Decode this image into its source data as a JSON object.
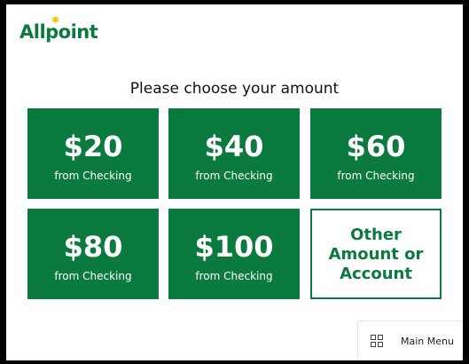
{
  "brand": {
    "name": "Allpoint",
    "color": "#0b7a3e",
    "star_color": "#f2c500"
  },
  "prompt": "Please choose your amount",
  "options": [
    {
      "amount": "$20",
      "source": "from Checking"
    },
    {
      "amount": "$40",
      "source": "from Checking"
    },
    {
      "amount": "$60",
      "source": "from Checking"
    },
    {
      "amount": "$80",
      "source": "from Checking"
    },
    {
      "amount": "$100",
      "source": "from Checking"
    }
  ],
  "other_option": {
    "label": "Other\nAmount or\nAccount"
  },
  "main_menu": {
    "label": "Main Menu",
    "icon": "grid-icon"
  }
}
